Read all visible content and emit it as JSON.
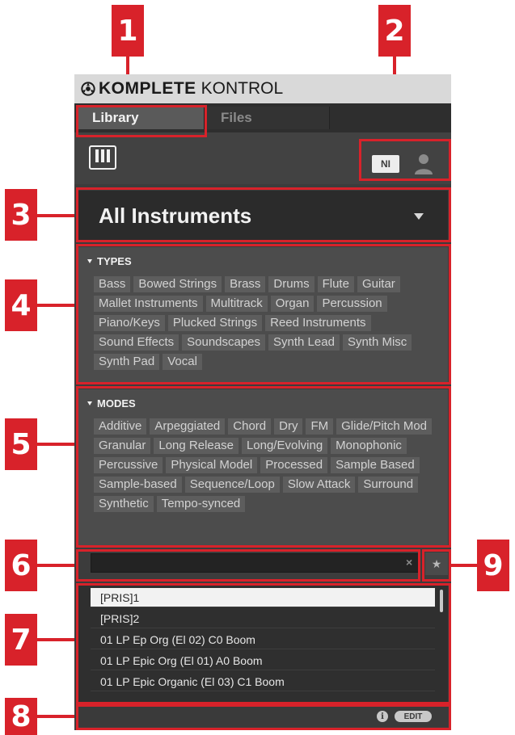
{
  "callouts": [
    "1",
    "2",
    "3",
    "4",
    "5",
    "6",
    "7",
    "8",
    "9"
  ],
  "app": {
    "brand_bold": "KOMPLETE",
    "brand_light": "KONTROL",
    "logo_icon": "komplete-logo-icon"
  },
  "tabs": [
    {
      "label": "Library",
      "active": true
    },
    {
      "label": "Files",
      "active": false
    }
  ],
  "toolbar": {
    "instrument_icon": "keyboard-icon",
    "factory_label": "NI",
    "user_icon": "user-icon"
  },
  "selector": {
    "value": "All Instruments"
  },
  "types": {
    "title": "TYPES",
    "tags": [
      "Bass",
      "Bowed Strings",
      "Brass",
      "Drums",
      "Flute",
      "Guitar",
      "Mallet Instruments",
      "Multitrack",
      "Organ",
      "Percussion",
      "Piano/Keys",
      "Plucked Strings",
      "Reed Instruments",
      "Sound Effects",
      "Soundscapes",
      "Synth Lead",
      "Synth Misc",
      "Synth Pad",
      "Vocal"
    ]
  },
  "modes": {
    "title": "MODES",
    "tags": [
      "Additive",
      "Arpeggiated",
      "Chord",
      "Dry",
      "FM",
      "Glide/Pitch Mod",
      "Granular",
      "Long Release",
      "Long/Evolving",
      "Monophonic",
      "Percussive",
      "Physical Model",
      "Processed",
      "Sample Based",
      "Sample-based",
      "Sequence/Loop",
      "Slow Attack",
      "Surround",
      "Synthetic",
      "Tempo-synced"
    ]
  },
  "search": {
    "value": "",
    "placeholder": "",
    "clear_glyph": "×",
    "favorites_glyph": "★"
  },
  "results": [
    "[PRIS]1",
    "[PRIS]2",
    "01 LP Ep Org (El 02) C0 Boom",
    "01 LP Epic Org (El 01) A0 Boom",
    "01 LP Epic Organic (El 03) C1 Boom"
  ],
  "statusbar": {
    "info_glyph": "i",
    "edit_label": "EDIT"
  },
  "colors": {
    "callout": "#d8222a",
    "panel_bg": "#3c3c3c",
    "tag_bg": "#5d5d5d"
  }
}
